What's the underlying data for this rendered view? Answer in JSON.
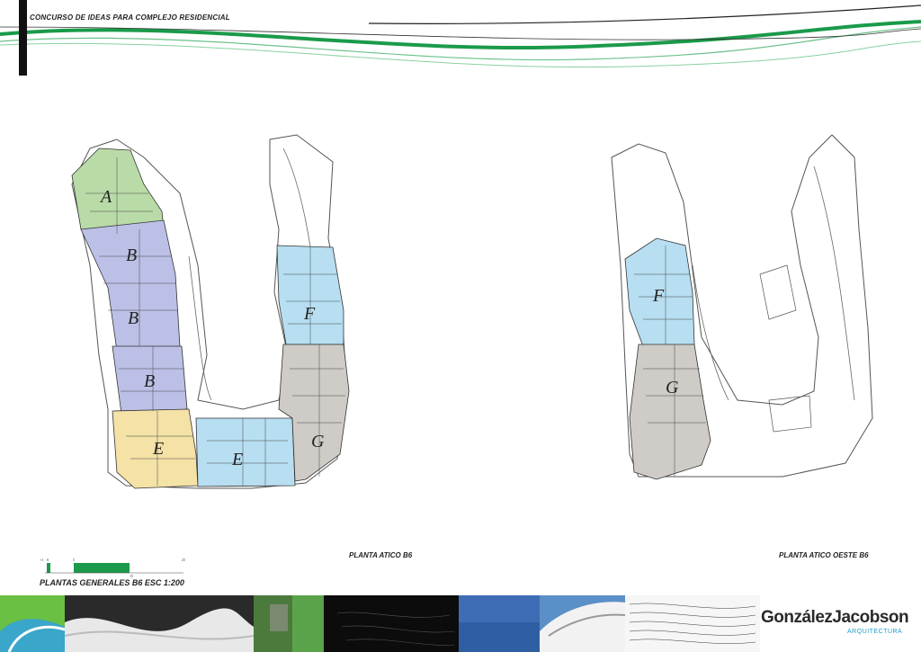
{
  "header": {
    "title": "CONCURSO DE IDEAS PARA COMPLEJO RESIDENCIAL"
  },
  "plans": {
    "left": {
      "label": "PLANTA ATICO B6",
      "units": [
        "A",
        "B",
        "B",
        "B",
        "E",
        "E",
        "F",
        "G"
      ]
    },
    "right": {
      "label": "PLANTA ATICO  OESTE B6",
      "units": [
        "F",
        "G"
      ]
    }
  },
  "scale": {
    "title": "PLANTAS GENERALES B6 ESC 1:200",
    "ticks": [
      "+1",
      "0",
      "5",
      "15",
      "25"
    ]
  },
  "brand": {
    "name": "GonzálezJacobson",
    "sub": "ARQUITECTURA"
  },
  "colors": {
    "unit_a": "#b9dba7",
    "unit_b": "#bcc0e6",
    "unit_e": "#f4e2a6",
    "unit_f": "#b7def1",
    "unit_g": "#cfcbc6",
    "accent_green": "#1a9a4a"
  }
}
